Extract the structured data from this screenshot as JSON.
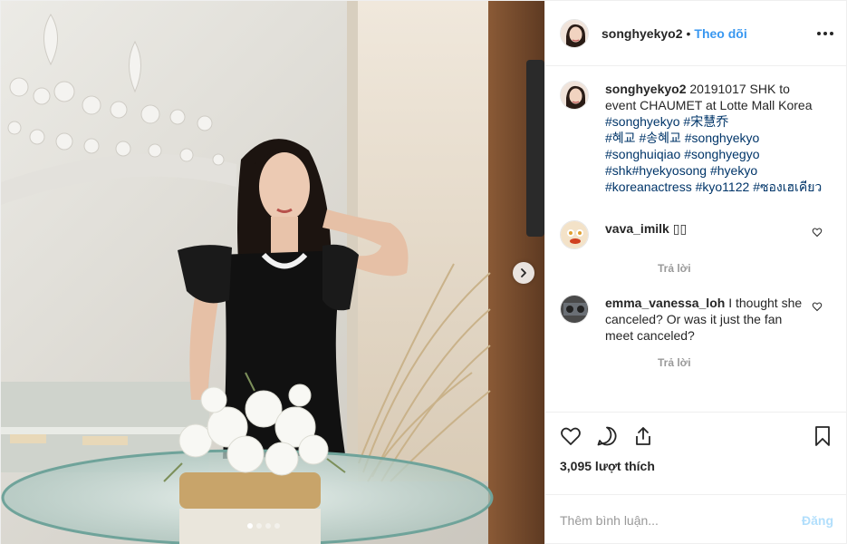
{
  "post": {
    "username": "songhyekyo2",
    "separator": "•",
    "follow_label": "Theo dõi",
    "caption_text": "20191017 SHK to event CHAUMET at Lotte Mall Korea",
    "hashtags": [
      "#songhyekyo",
      "#宋慧乔",
      "#혜교",
      "#송혜교",
      "#songhyekyo",
      "#songhuiqiao",
      "#songhyegyo",
      "#shk",
      "#hyekyosong",
      "#hyekyo",
      "#koreanactress",
      "#kyo1122",
      "#ซองเฮเคียว"
    ],
    "likes_text": "3,095 lượt thích",
    "more_options_icon": "more-horizontal-icon",
    "next_icon": "chevron-right-icon"
  },
  "comments": [
    {
      "username": "vava_imilk",
      "text": "▯▯",
      "reply_label": "Trả lời"
    },
    {
      "username": "emma_vanessa_loh",
      "text": "I thought she canceled? Or was it just the fan meet canceled?",
      "reply_label": "Trả lời"
    }
  ],
  "actions": {
    "like_icon": "heart-icon",
    "comment_icon": "comment-icon",
    "share_icon": "share-icon",
    "save_icon": "bookmark-icon"
  },
  "comment_box": {
    "placeholder": "Thêm bình luận...",
    "post_label": "Đăng"
  },
  "carousel": {
    "count": 4,
    "active_index": 0
  },
  "colors": {
    "accent": "#3897f0",
    "post_disabled": "#b2dffc",
    "hashtag": "#003569",
    "muted": "#999999"
  }
}
